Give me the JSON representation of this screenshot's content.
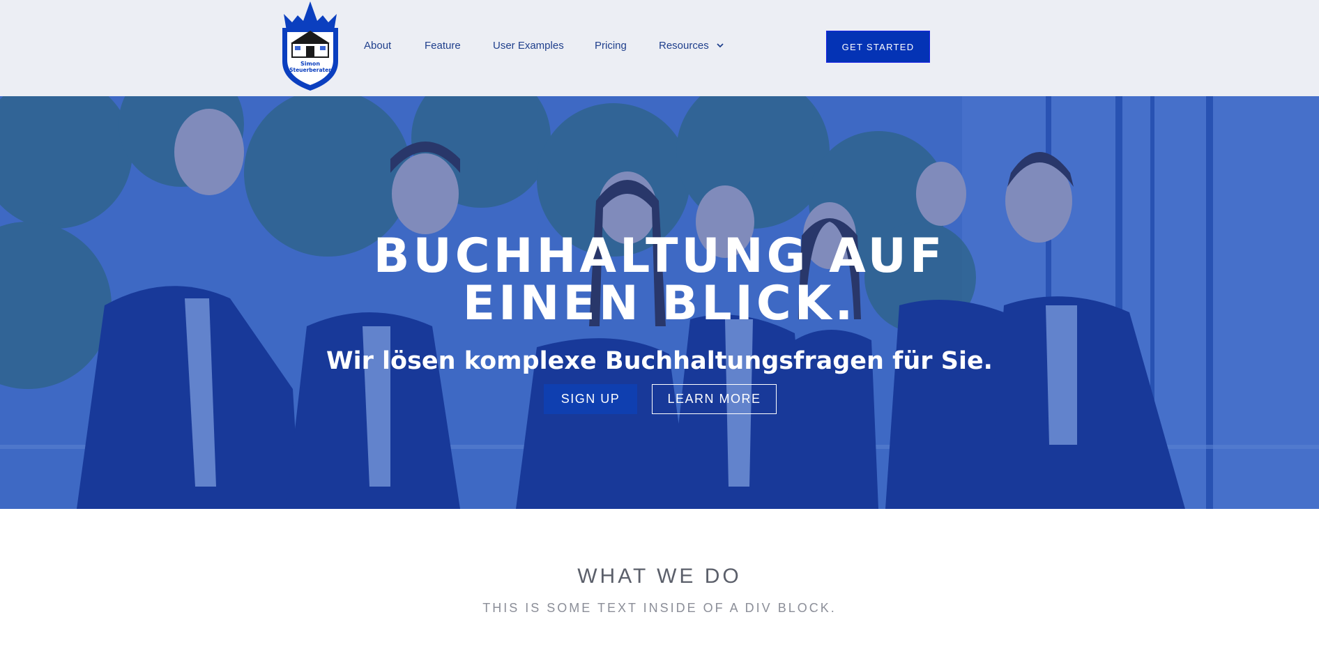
{
  "brand": {
    "logo_line1": "Simon",
    "logo_line2": "Steuerberater",
    "primary_color": "#0433b5"
  },
  "nav": {
    "items": [
      {
        "label": "About"
      },
      {
        "label": "Feature"
      },
      {
        "label": "User Examples"
      },
      {
        "label": "Pricing"
      },
      {
        "label": "Resources",
        "icon": "chevron-down-icon"
      }
    ],
    "cta_label": "GET STARTED"
  },
  "hero": {
    "title_line1": "BUCHHALTUNG AUF",
    "title_line2": "EINEN BLICK.",
    "subtitle": "Wir lösen komplexe Buchhaltungsfragen für Sie.",
    "signup_label": "SIGN UP",
    "learn_label": "LEARN MORE",
    "image": "team-photo"
  },
  "section": {
    "title": "WHAT WE DO",
    "subtitle": "THIS IS SOME TEXT INSIDE OF A DIV BLOCK."
  }
}
